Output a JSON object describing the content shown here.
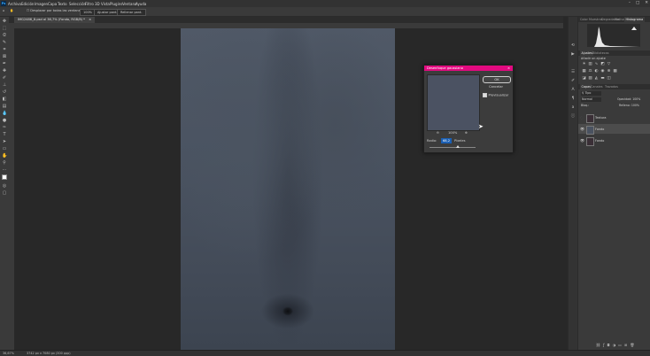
{
  "menubar": {
    "app_icon": "Ps",
    "items": [
      "Archivo",
      "Edición",
      "Imagen",
      "Capa",
      "Texto",
      "Selección",
      "Filtro",
      "3D",
      "Vista",
      "Plugins",
      "Ventana",
      "Ayuda"
    ]
  },
  "options": {
    "scroll_all": "Desplazar por todas las ventanas",
    "zoom_value": "100%",
    "fit_screen": "Ajustar pant.",
    "fill_screen": "Rellenar pant."
  },
  "document": {
    "tab_title": "IMG2486_8.psd al 36,7% (Fondo, RGB/8) *",
    "close_glyph": "×"
  },
  "status": {
    "zoom": "36,67%",
    "size": "3742 px x 7080 px (300 ppp)"
  },
  "panels": {
    "top_tabs": [
      "Color",
      "Muestras",
      "Degradados",
      "Motivos",
      "Histograma"
    ],
    "adjust_tabs": [
      "Ajustes",
      "Bibliotecas"
    ],
    "adjust_label": "Añadir un ajuste",
    "layer_tabs": [
      "Capas",
      "Canales",
      "Trazados"
    ],
    "layer_search": "Tipo",
    "layer_mode": "Normal",
    "layer_opacity": "Opacidad: 100%",
    "layer_fill": "Relleno: 100%",
    "lock_label": "Bloq.:",
    "layers": [
      {
        "name": "Textura",
        "visible": false,
        "selected": false
      },
      {
        "name": "Fondo",
        "visible": true,
        "selected": true
      },
      {
        "name": "Fondo",
        "visible": true,
        "selected": false
      }
    ]
  },
  "dialog": {
    "title": "Desenfoque gaussiano",
    "close_glyph": "×",
    "ok": "OK",
    "cancel": "Cancelar",
    "preview_label": "Previsualizar",
    "preview_checked": true,
    "zoom": "100%",
    "radius_label": "Radio:",
    "radius_value": "68,2",
    "radius_unit": "Píxeles",
    "slider_fraction": 0.62
  },
  "colors": {
    "accent_title": "#e20a80",
    "canvas_bg": "#282828",
    "panel_bg": "#3a3a3a",
    "image_tone": "#4a5361"
  }
}
